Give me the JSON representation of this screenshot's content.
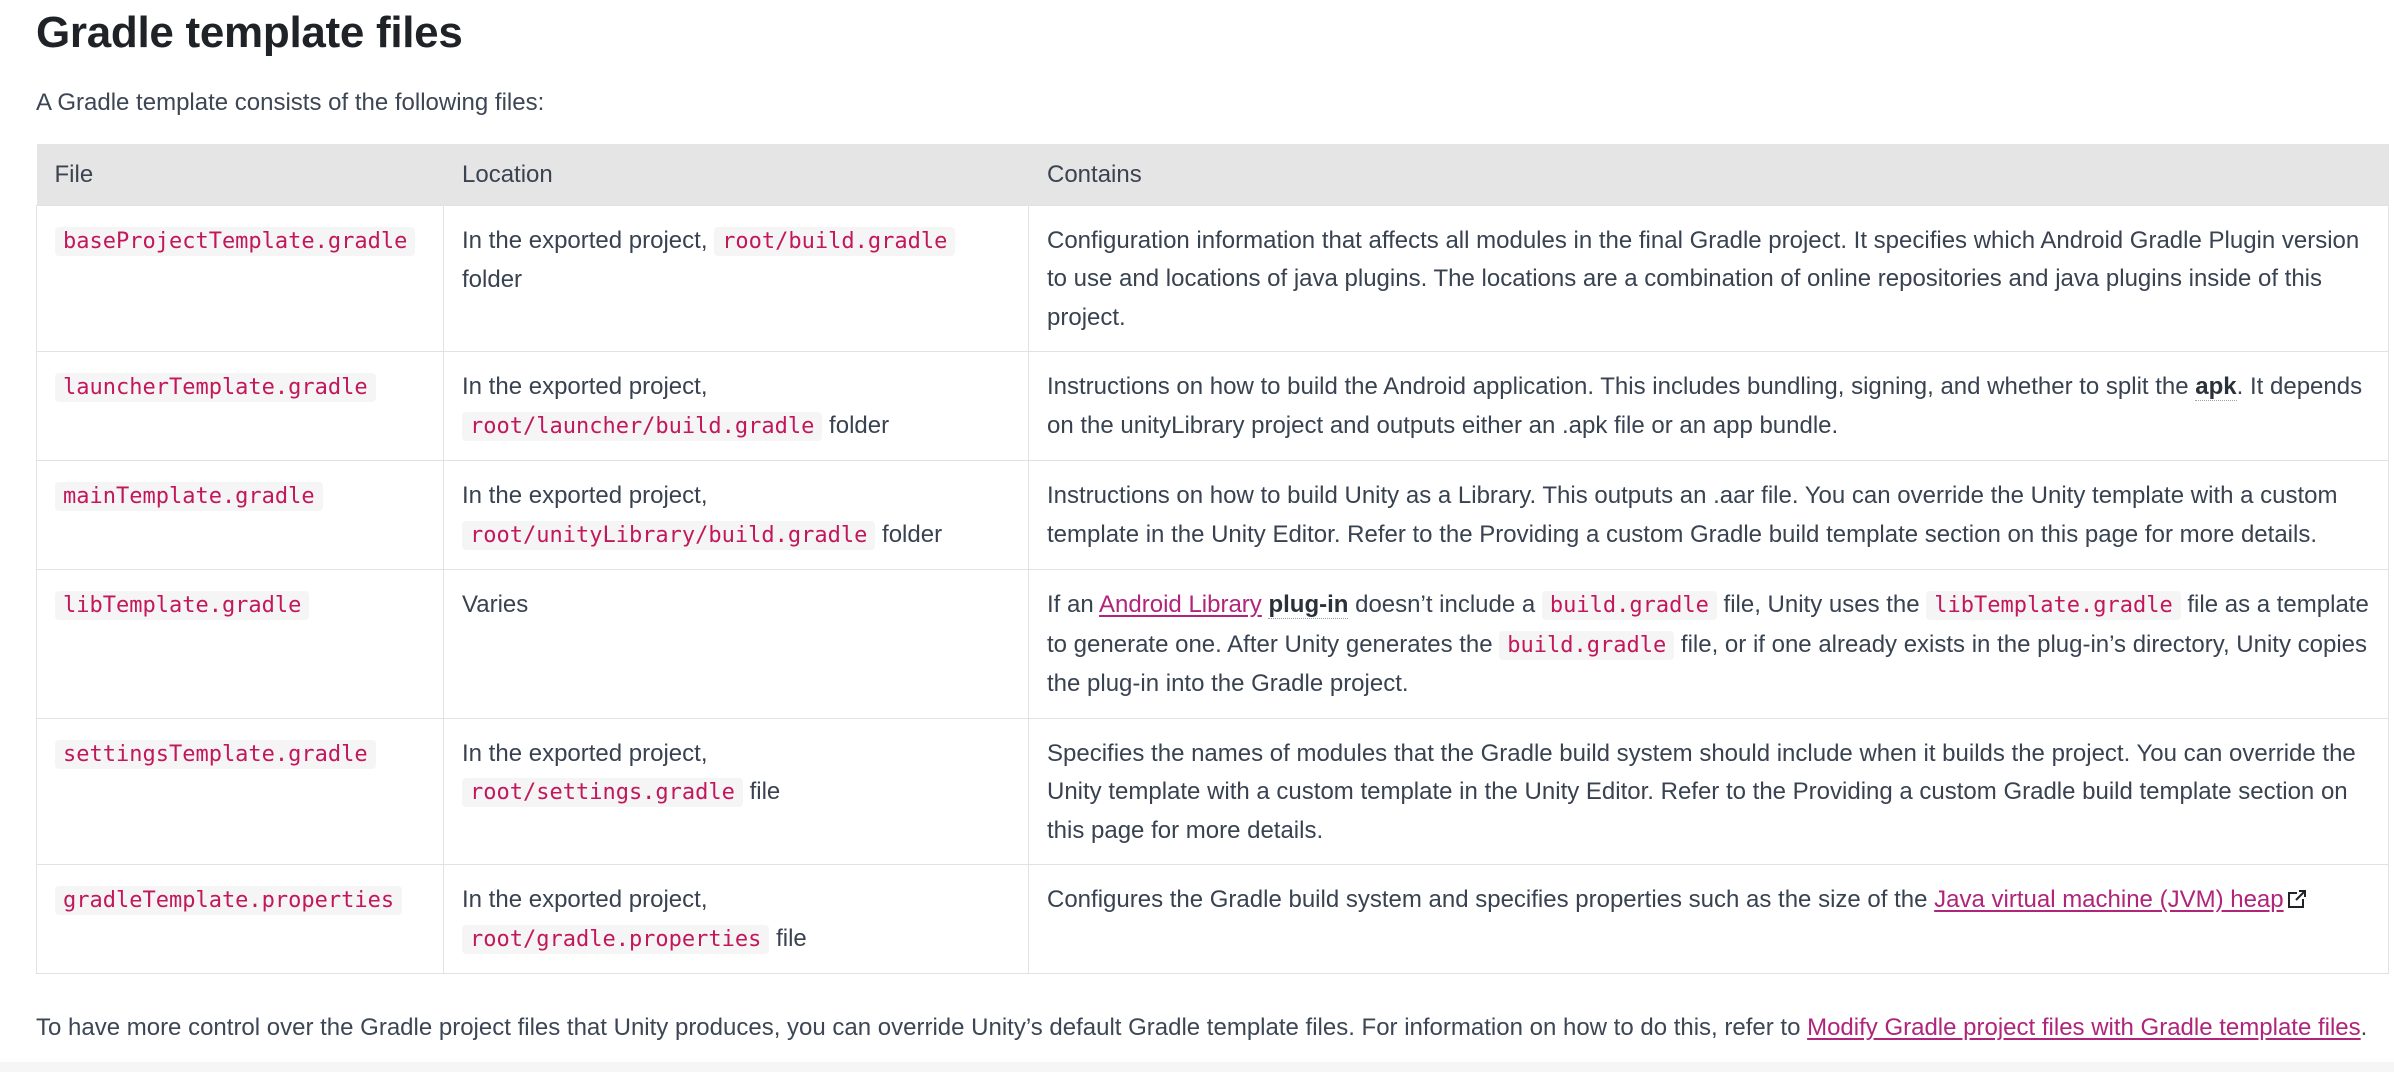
{
  "page": {
    "title": "Gradle template files",
    "intro": "A Gradle template consists of the following files:"
  },
  "table": {
    "headers": [
      "File",
      "Location",
      "Contains"
    ],
    "rows": [
      {
        "file": "baseProjectTemplate.gradle",
        "location_prefix": "In the exported project,",
        "location_code": "root/build.gradle",
        "location_suffix": "folder",
        "contains": "Configuration information that affects all modules in the final Gradle project. It specifies which Android Gradle Plugin version to use and locations of java plugins. The locations are a combination of online repositories and java plugins inside of this project."
      },
      {
        "file": "launcherTemplate.gradle",
        "location_prefix": "In the exported project,",
        "location_code": "root/launcher/build.gradle",
        "location_suffix": "folder",
        "contains_before": "Instructions on how to build the Android application. This includes bundling, signing, and whether to split the ",
        "contains_term": "apk",
        "contains_after": ". It depends on the unityLibrary project and outputs either an .apk file or an app bundle."
      },
      {
        "file": "mainTemplate.gradle",
        "location_prefix": "In the exported project,",
        "location_code": "root/unityLibrary/build.gradle",
        "location_suffix": "folder",
        "contains": "Instructions on how to build Unity as a Library. This outputs an .aar file. You can override the Unity template with a custom template in the Unity Editor. Refer to the Providing a custom Gradle build template section on this page for more details."
      },
      {
        "file": "libTemplate.gradle",
        "location": "Varies",
        "contains_1": "If an ",
        "contains_link": "Android Library",
        "contains_2": " ",
        "contains_term": "plug-in",
        "contains_3": " doesn’t include a ",
        "contains_code_1": "build.gradle",
        "contains_4": " file, Unity uses the ",
        "contains_code_2": "libTemplate.gradle",
        "contains_5": " file as a template to generate one. After Unity generates the ",
        "contains_code_3": "build.gradle",
        "contains_6": " file, or if one already exists in the plug-in’s directory, Unity copies the plug-in into the Gradle project."
      },
      {
        "file": "settingsTemplate.gradle",
        "location_prefix": "In the exported project,",
        "location_code": "root/settings.gradle",
        "location_suffix": "file",
        "contains": "Specifies the names of modules that the Gradle build system should include when it builds the project. You can override the Unity template with a custom template in the Unity Editor. Refer to the Providing a custom Gradle build template section on this page for more details."
      },
      {
        "file": "gradleTemplate.properties",
        "location_prefix": "In the exported project,",
        "location_code": "root/gradle.properties",
        "location_suffix": "file",
        "contains_before": "Configures the Gradle build system and specifies properties such as the size of the ",
        "contains_link": "Java virtual machine (JVM) heap"
      }
    ]
  },
  "outro": {
    "text": "To have more control over the Gradle project files that Unity produces, you can override Unity’s default Gradle template files. For information on how to do this, refer to ",
    "link": "Modify Gradle project files with Gradle template files",
    "end": "."
  },
  "colors": {
    "link": "#b0247a",
    "code": "#c2185b",
    "header_bg": "#e5e5e5",
    "text": "#384250"
  },
  "icons": {
    "external_link": "external-link-icon"
  }
}
